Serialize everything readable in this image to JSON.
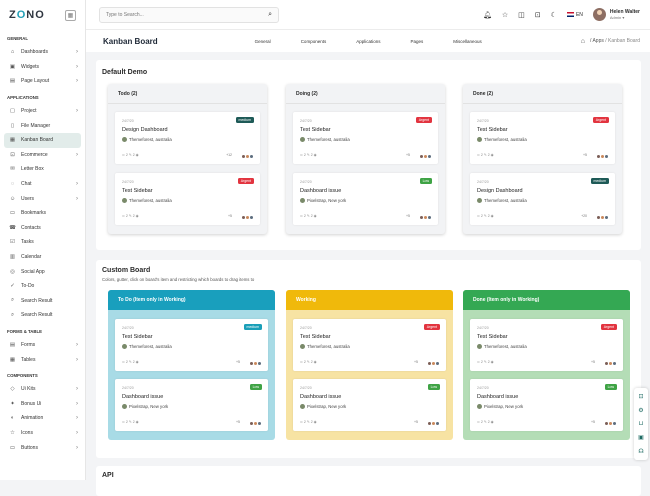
{
  "sidebar": {
    "logo_left": "Z",
    "logo_accent": "O",
    "logo_right": "NO",
    "sections": [
      {
        "label": "GENERAL",
        "items": [
          {
            "label": "Dashboards",
            "icon": "home-icon",
            "glyph": "⌂",
            "arrow": true
          },
          {
            "label": "Widgets",
            "icon": "widget-icon",
            "glyph": "▣",
            "arrow": true
          },
          {
            "label": "Page Layout",
            "icon": "layout-icon",
            "glyph": "▤",
            "arrow": true
          }
        ]
      },
      {
        "label": "APPLICATIONS",
        "items": [
          {
            "label": "Project",
            "icon": "folder-icon",
            "glyph": "▢",
            "arrow": true
          },
          {
            "label": "File Manager",
            "icon": "file-icon",
            "glyph": "▯",
            "arrow": false
          },
          {
            "label": "Kanban Board",
            "icon": "kanban-icon",
            "glyph": "▦",
            "arrow": false,
            "active": true
          },
          {
            "label": "Ecommerce",
            "icon": "cart-icon",
            "glyph": "⊡",
            "arrow": true
          },
          {
            "label": "Letter Box",
            "icon": "mail-icon",
            "glyph": "✉",
            "arrow": false
          },
          {
            "label": "Chat",
            "icon": "chat-icon",
            "glyph": "◌",
            "arrow": true
          },
          {
            "label": "Users",
            "icon": "user-icon",
            "glyph": "☺",
            "arrow": true
          },
          {
            "label": "Bookmarks",
            "icon": "bookmark-icon",
            "glyph": "▭",
            "arrow": false
          },
          {
            "label": "Contacts",
            "icon": "contacts-icon",
            "glyph": "☎",
            "arrow": false
          },
          {
            "label": "Tasks",
            "icon": "tasks-icon",
            "glyph": "☑",
            "arrow": false
          },
          {
            "label": "Calendar",
            "icon": "calendar-icon",
            "glyph": "▥",
            "arrow": false
          },
          {
            "label": "Social App",
            "icon": "social-icon",
            "glyph": "◎",
            "arrow": false
          },
          {
            "label": "To-Do",
            "icon": "todo-icon",
            "glyph": "✓",
            "arrow": false
          },
          {
            "label": "Search Result",
            "icon": "search-icon",
            "glyph": "⌕",
            "arrow": false
          },
          {
            "label": "Search Result",
            "icon": "search-icon",
            "glyph": "⌕",
            "arrow": false
          }
        ]
      },
      {
        "label": "FORMS & TABLE",
        "items": [
          {
            "label": "Forms",
            "icon": "forms-icon",
            "glyph": "▤",
            "arrow": true
          },
          {
            "label": "Tables",
            "icon": "table-icon",
            "glyph": "▦",
            "arrow": true
          }
        ]
      },
      {
        "label": "COMPONENTS",
        "items": [
          {
            "label": "Ui Kits",
            "icon": "ui-kits-icon",
            "glyph": "◇",
            "arrow": true
          },
          {
            "label": "Bonus Ui",
            "icon": "bonus-icon",
            "glyph": "✦",
            "arrow": true
          },
          {
            "label": "Animation",
            "icon": "animation-icon",
            "glyph": "◐",
            "arrow": true
          },
          {
            "label": "Icons",
            "icon": "icons-icon",
            "glyph": "☆",
            "arrow": true
          },
          {
            "label": "Buttons",
            "icon": "buttons-icon",
            "glyph": "▭",
            "arrow": true
          }
        ]
      }
    ]
  },
  "topbar": {
    "search_placeholder": "Type to Search...",
    "lang": "EN",
    "user_name": "Helen Walter",
    "user_role": "Admin"
  },
  "title_bar": {
    "title": "Kanban Board",
    "nav": [
      "General",
      "Components",
      "Applications",
      "Pages",
      "Miscellaneous"
    ],
    "crumb_1": "/ Apps",
    "crumb_2": "/ Kanban Board"
  },
  "default_demo": {
    "title": "Default Demo",
    "columns": [
      {
        "label": "Todo (2)",
        "cards": [
          {
            "date": "24/7/20",
            "badge": "medium",
            "badge_color": "#1e5a57",
            "title": "Design Dashboard",
            "sub": "Themeforest, australia",
            "meta": "⊂ 2   ✎ 2   ◉",
            "count": "+12"
          },
          {
            "date": "24/7/20",
            "badge": "Argent",
            "badge_color": "#e2343f",
            "title": "Test Sidebar",
            "sub": "Themeforest, australia",
            "meta": "⊂ 2   ✎ 2   ◉",
            "count": "+5"
          }
        ]
      },
      {
        "label": "Doing (2)",
        "cards": [
          {
            "date": "24/7/20",
            "badge": "Argent",
            "badge_color": "#e2343f",
            "title": "Test Sidebar",
            "sub": "Themeforest, australia",
            "meta": "⊂ 2   ✎ 2   ◉",
            "count": "+5"
          },
          {
            "date": "24/7/20",
            "badge": "Low",
            "badge_color": "#3fa345",
            "title": "Dashboard issue",
            "sub": "Pixelstrap, New york",
            "meta": "⊂ 2   ✎ 2   ◉",
            "count": "+5"
          }
        ]
      },
      {
        "label": "Done (2)",
        "cards": [
          {
            "date": "24/7/20",
            "badge": "Argent",
            "badge_color": "#e2343f",
            "title": "Test Sidebar",
            "sub": "Themeforest, australia",
            "meta": "⊂ 2   ✎ 2   ◉",
            "count": "+5"
          },
          {
            "date": "24/7/20",
            "badge": "medium",
            "badge_color": "#1e5a57",
            "title": "Design Dashboard",
            "sub": "Themeforest, australia",
            "meta": "⊂ 2   ✎ 2   ◉",
            "count": "+20"
          }
        ]
      }
    ]
  },
  "custom_board": {
    "title": "Custom Board",
    "subtitle": "Colors, gutter, click on board's item and restricting which boards to drag items to",
    "columns": [
      {
        "label": "To Do (Item only in Working)",
        "head_color": "#199fbd",
        "body_color": "#a8dbe6",
        "label_color": "#ffffff",
        "cards": [
          {
            "date": "24/7/20",
            "badge": "medium",
            "badge_color": "#1a9fb8",
            "title": "Test Sidebar",
            "sub": "Themeforest, australia",
            "meta": "⊂ 2   ✎ 2   ◉",
            "count": "+5"
          },
          {
            "date": "24/7/20",
            "badge": "Low",
            "badge_color": "#3fa345",
            "title": "Dashboard issue",
            "sub": "Pixelstrap, New york",
            "meta": "⊂ 2   ✎ 2   ◉",
            "count": "+5"
          }
        ]
      },
      {
        "label": "Working",
        "head_color": "#f0b90b",
        "body_color": "#f7e3a3",
        "label_color": "#ffffff",
        "cards": [
          {
            "date": "24/7/20",
            "badge": "Argent",
            "badge_color": "#e2343f",
            "title": "Test Sidebar",
            "sub": "Themeforest, australia",
            "meta": "⊂ 2   ✎ 2   ◉",
            "count": "+5"
          },
          {
            "date": "24/7/20",
            "badge": "Low",
            "badge_color": "#3fa345",
            "title": "Dashboard issue",
            "sub": "Pixelstrap, New york",
            "meta": "⊂ 2   ✎ 2   ◉",
            "count": "+5"
          }
        ]
      },
      {
        "label": "Done (Item only in Working)",
        "head_color": "#34a853",
        "body_color": "#b4ddb6",
        "label_color": "#ffffff",
        "cards": [
          {
            "date": "24/7/20",
            "badge": "Argent",
            "badge_color": "#e2343f",
            "title": "Test Sidebar",
            "sub": "Themeforest, australia",
            "meta": "⊂ 2   ✎ 2   ◉",
            "count": "+5"
          },
          {
            "date": "24/7/20",
            "badge": "Low",
            "badge_color": "#3fa345",
            "title": "Dashboard issue",
            "sub": "Pixelstrap, New york",
            "meta": "⊂ 2   ✎ 2   ◉",
            "count": "+5"
          }
        ]
      }
    ]
  },
  "api": {
    "title": "API"
  },
  "fab_icons": [
    "cart-icon",
    "gear-icon",
    "basket-icon",
    "chat-icon",
    "support-icon"
  ]
}
